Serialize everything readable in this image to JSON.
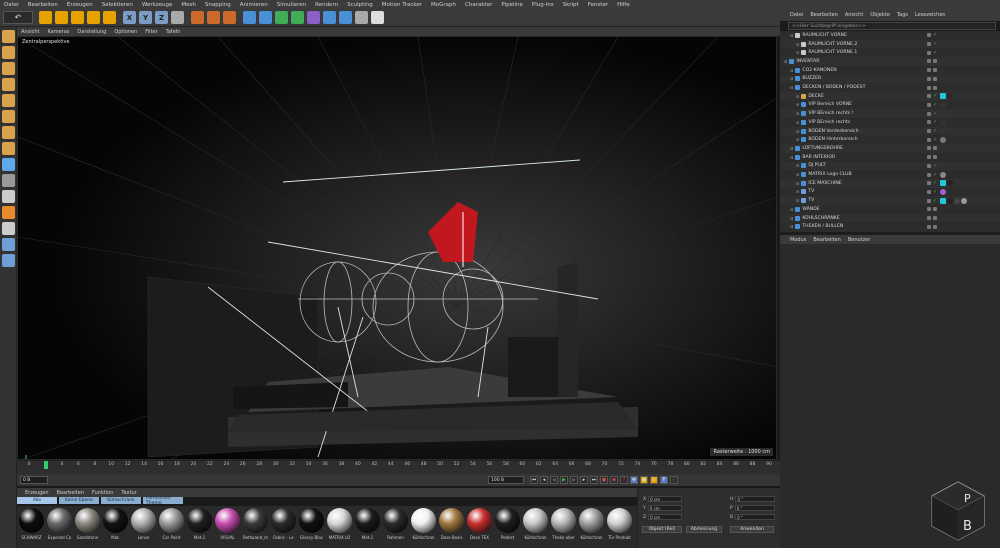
{
  "menubar": [
    "Datei",
    "Bearbeiten",
    "Erzeugen",
    "Selektieren",
    "Werkzeuge",
    "Mesh",
    "Snapping",
    "Animieren",
    "Simulieren",
    "Rendern",
    "Sculpting",
    "Motion Tracker",
    "MoGraph",
    "Charakter",
    "Pipeline",
    "Plug-ins",
    "Skript",
    "Fenster",
    "Hilfe"
  ],
  "toolbar": {
    "undo_icon": "undo-icon",
    "buttons": [
      {
        "name": "live-selection-icon",
        "color": "#e6a300"
      },
      {
        "name": "move-icon",
        "color": "#e6a300"
      },
      {
        "name": "scale-icon",
        "color": "#e6a300"
      },
      {
        "name": "rotate-icon",
        "color": "#e6a300"
      },
      {
        "name": "recent-tools-icon",
        "color": "#e6a300"
      },
      {
        "name": "x-axis-icon",
        "color": "#7a9cc6",
        "label": "X"
      },
      {
        "name": "y-axis-icon",
        "color": "#7a9cc6",
        "label": "Y"
      },
      {
        "name": "z-axis-icon",
        "color": "#7a9cc6",
        "label": "Z"
      },
      {
        "name": "world-coords-icon",
        "color": "#aaaaaa"
      },
      {
        "name": "render-view-icon",
        "color": "#cc6a2a"
      },
      {
        "name": "render-picture-viewer-icon",
        "color": "#cc6a2a"
      },
      {
        "name": "render-settings-icon",
        "color": "#cc6a2a"
      },
      {
        "name": "cube-icon",
        "color": "#4a90d9"
      },
      {
        "name": "pen-icon",
        "color": "#4a90d9"
      },
      {
        "name": "subdivision-icon",
        "color": "#3fae5a"
      },
      {
        "name": "array-icon",
        "color": "#3fae5a"
      },
      {
        "name": "deformer-icon",
        "color": "#8a5fc6"
      },
      {
        "name": "field-icon",
        "color": "#4a90d9"
      },
      {
        "name": "floor-icon",
        "color": "#4a90d9"
      },
      {
        "name": "camera-icon",
        "color": "#aaaaaa"
      },
      {
        "name": "light-icon",
        "color": "#dddddd"
      }
    ]
  },
  "leftbar": [
    {
      "name": "make-editable-icon",
      "color": "#d9a24c"
    },
    {
      "name": "model-mode-icon",
      "color": "#d9a24c"
    },
    {
      "name": "texture-mode-icon",
      "color": "#d9a24c"
    },
    {
      "name": "workplane-icon",
      "color": "#d9a24c"
    },
    {
      "name": "points-mode-icon",
      "color": "#d9a24c"
    },
    {
      "name": "edges-mode-icon",
      "color": "#d9a24c"
    },
    {
      "name": "polygons-mode-icon",
      "color": "#d9a24c"
    },
    {
      "name": "axis-mode-icon",
      "color": "#d9a24c"
    },
    {
      "name": "tweak-mode-icon",
      "color": "#5da9e9"
    },
    {
      "name": "snap-icon",
      "color": "#999999"
    },
    {
      "name": "enable-snap-icon",
      "color": "#cccccc"
    },
    {
      "name": "workplane-lock-icon",
      "color": "#e88a2c"
    },
    {
      "name": "solo-icon",
      "color": "#cccccc"
    },
    {
      "name": "grid-icon",
      "color": "#6f9fd6"
    },
    {
      "name": "planar-workplane-icon",
      "color": "#6f9fd6"
    }
  ],
  "viewport": {
    "menu": [
      "Ansicht",
      "Kameras",
      "Darstellung",
      "Optionen",
      "Filter",
      "Tafeln"
    ],
    "label": "Zentralperspektive",
    "status": "Rasterweite : 1000 cm"
  },
  "timeline": {
    "ticks": [
      "0",
      "2",
      "4",
      "6",
      "8",
      "10",
      "12",
      "14",
      "16",
      "18",
      "20",
      "22",
      "24",
      "26",
      "28",
      "30",
      "32",
      "34",
      "36",
      "38",
      "40",
      "42",
      "44",
      "46",
      "48",
      "50",
      "52",
      "54",
      "56",
      "58",
      "60",
      "62",
      "64",
      "66",
      "68",
      "70",
      "72",
      "74",
      "76",
      "78",
      "80",
      "82",
      "84",
      "86",
      "88",
      "90"
    ],
    "current_frame": "0 B",
    "start_field": "0 B",
    "end_field": "100 B",
    "end_display": "0 B"
  },
  "materials": {
    "menu": [
      "Erzeugen",
      "Bearbeiten",
      "Funktion",
      "Textur"
    ],
    "tabs": [
      "Alle",
      "Keine Ebene",
      "Kühlschrank",
      "Formschön Theme"
    ],
    "items": [
      {
        "name": "SCHWARZ",
        "color": "#0d0d0d"
      },
      {
        "name": "Exposed Co",
        "color": "#6a6a6a"
      },
      {
        "name": "Sandstone",
        "color": "#8e8a82"
      },
      {
        "name": "Mat.",
        "color": "#121212"
      },
      {
        "name": "Lense",
        "color": "#b0b0b0"
      },
      {
        "name": "Car Paint",
        "color": "#9c9c9c"
      },
      {
        "name": "Mat.1",
        "color": "#202020"
      },
      {
        "name": "VISUAL",
        "color": "#c84fb0"
      },
      {
        "name": "Bettwand_m",
        "color": "#3a3a3a"
      },
      {
        "name": "Fabric - Le",
        "color": "#2b2b2b"
      },
      {
        "name": "Glossy Blac",
        "color": "#111111"
      },
      {
        "name": "MATRIX LO",
        "color": "#d8d8d8"
      },
      {
        "name": "Mat.1",
        "color": "#1c1c1c"
      },
      {
        "name": "Rahmen",
        "color": "#2a2a2a"
      },
      {
        "name": "Kühlschran",
        "color": "#f2f2f2"
      },
      {
        "name": "Dose Basis",
        "color": "#a07a40"
      },
      {
        "name": "Dose TEX",
        "color": "#c83232"
      },
      {
        "name": "Podest",
        "color": "#1e1e1e"
      },
      {
        "name": "Kühlschran",
        "color": "#c8c8c8"
      },
      {
        "name": "Theke ober",
        "color": "#b8b8b8"
      },
      {
        "name": "Kühlschran",
        "color": "#a0a0a0"
      },
      {
        "name": "Tür Produkt",
        "color": "#d0d0d0"
      }
    ]
  },
  "coords": {
    "x_label": "X",
    "y_label": "Y",
    "z_label": "Z",
    "h_label": "H",
    "p_label": "P",
    "b_label": "B",
    "value": "0 cm",
    "angle": "0 °",
    "mode_dropdown": "Objekt (Rel)",
    "size_dropdown": "Abmessung",
    "apply_button": "Anwenden"
  },
  "objects": {
    "menu": [
      "Datei",
      "Bearbeiten",
      "Ansicht",
      "Objekte",
      "Tags",
      "Lesezeichen"
    ],
    "search_placeholder": "<<Hier Suchbegriff eingeben>>",
    "rows": [
      {
        "label": "RAUMLICHT VORNE",
        "indent": 1,
        "icon": "#c9c9c9",
        "check": true
      },
      {
        "label": "RAUMLICHT VORNE.2",
        "indent": 2,
        "icon": "#c9c9c9",
        "check": true
      },
      {
        "label": "RAUMLICHT VORNE.1",
        "indent": 2,
        "icon": "#c9c9c9",
        "check": true
      },
      {
        "label": "INVENTAR",
        "indent": 0,
        "icon": "#4a90d9",
        "check": false
      },
      {
        "label": "CO2-KANONEN",
        "indent": 1,
        "icon": "#4a90d9",
        "check": false
      },
      {
        "label": "BUZZER",
        "indent": 1,
        "icon": "#4a90d9",
        "check": false
      },
      {
        "label": "DECKEN / BODEN / PODEST",
        "indent": 1,
        "icon": "#4a90d9",
        "check": false
      },
      {
        "label": "DECKE",
        "indent": 2,
        "icon": "#d9a24c",
        "check": true,
        "tags": [
          "#1ec8d8",
          "#2a2a2a"
        ]
      },
      {
        "label": "VIP Bereich VORNE",
        "indent": 2,
        "icon": "#4a90d9",
        "check": true,
        "tags": [
          "#333333"
        ]
      },
      {
        "label": "VIP BEreich rechts !",
        "indent": 2,
        "icon": "#4a90d9",
        "check": true,
        "tags": [
          "#333333"
        ]
      },
      {
        "label": "VIP BEreich rechts",
        "indent": 2,
        "icon": "#4a90d9",
        "check": true,
        "tags": [
          "#333333"
        ]
      },
      {
        "label": "BODEN Vorderbereich",
        "indent": 2,
        "icon": "#4a90d9",
        "check": true,
        "tags": [
          "#333333"
        ]
      },
      {
        "label": "BODEN Hinterbereich",
        "indent": 2,
        "icon": "#4a90d9",
        "check": true,
        "tags": [
          "#777777"
        ]
      },
      {
        "label": "LÜFTUNGSROHRE",
        "indent": 1,
        "icon": "#4a90d9",
        "check": false
      },
      {
        "label": "BAR INTERIOR",
        "indent": 1,
        "icon": "#4a90d9",
        "check": false
      },
      {
        "label": "DJ PULT",
        "indent": 2,
        "icon": "#4a90d9",
        "check": true
      },
      {
        "label": "MATRIX Logo CLUB",
        "indent": 2,
        "icon": "#4a90d9",
        "check": true,
        "tags": [
          "#888888"
        ]
      },
      {
        "label": "ICE MASCHINE",
        "indent": 2,
        "icon": "#4a90d9",
        "check": true,
        "tags": [
          "#1ec8d8",
          "#222222"
        ]
      },
      {
        "label": "TV",
        "indent": 2,
        "icon": "#6f9fd6",
        "check": true,
        "tags": [
          "#a060d0"
        ]
      },
      {
        "label": "TV",
        "indent": 2,
        "icon": "#6f9fd6",
        "check": true,
        "tags": [
          "#1ec8d8",
          "#222222",
          "#444444",
          "#999999"
        ]
      },
      {
        "label": "WÄNDE",
        "indent": 1,
        "icon": "#4a90d9",
        "check": false
      },
      {
        "label": "KÜHLSCHRÄNKE",
        "indent": 1,
        "icon": "#4a90d9",
        "check": false
      },
      {
        "label": "THEKEN / BULLEN",
        "indent": 1,
        "icon": "#4a90d9",
        "check": false
      }
    ]
  },
  "attributes": {
    "menu": [
      "Modus",
      "Bearbeiten",
      "Benutzer"
    ]
  },
  "logo": {
    "text_top": "P",
    "text_bottom": "B"
  }
}
